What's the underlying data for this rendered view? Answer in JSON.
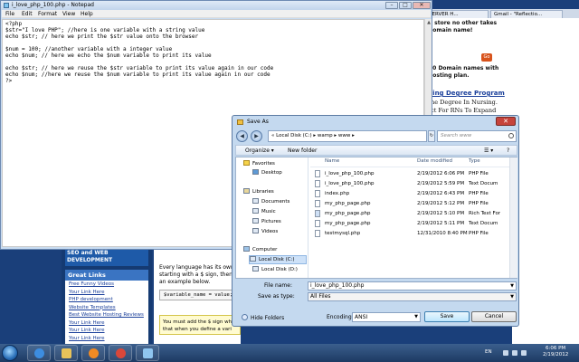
{
  "browser": {
    "tabs": [
      "SERVER H...",
      "Gmail - \"Reflectio..."
    ],
    "domain_lines": [
      "e store no other takes",
      "domain name!",
      "00 Domain names with",
      "hosting plan."
    ],
    "go_label": "Go",
    "promo_heading": "sing Degree Program",
    "promo_lines": [
      "ine Degree In Nursing.",
      "ict For RNs To Expand"
    ]
  },
  "site": {
    "sidebar_heading": "SEO and WEB DEVELOPMENT",
    "great_links_title": "Great Links",
    "great_links": [
      "Free Funny Videos",
      "Your Link Here",
      "PHP development",
      "Website Templates",
      "Best Website Hosting Reviews",
      "Your Link Here",
      "Your Link Here",
      "Your Link Here"
    ],
    "article_lines": [
      "Every language has its own",
      "starting with a $ sign, then",
      "an example below."
    ],
    "code_sample": "$variable_name = value;",
    "note_lines": [
      "You must add the $ sign when",
      "that when you define a vari"
    ]
  },
  "notepad": {
    "title": "i_love_php_100.php - Notepad",
    "menu": [
      "File",
      "Edit",
      "Format",
      "View",
      "Help"
    ],
    "code_lines": [
      "<?php",
      "$str=\"I love PHP\"; //here is one variable with a string value",
      "echo $str; // here we print the $str value onto the browser",
      "",
      "$num = 100; //another variable with a integer value",
      "echo $num; // here we echo the $num variable to print its value",
      "",
      "echo $str; // here we reuse the $str variable to print its value again in our code",
      "echo $num; //here we reuse the $num variable to print its value again in our code",
      "?>"
    ]
  },
  "save_dialog": {
    "title": "Save As",
    "address": "« Local Disk (C:) ▸ wamp ▸ www ▸",
    "search_placeholder": "Search www",
    "toolbar": {
      "organize": "Organize ▾",
      "new_folder": "New folder"
    },
    "nav": {
      "favorites": "Favorites",
      "desktop": "Desktop",
      "libraries": "Libraries",
      "documents": "Documents",
      "music": "Music",
      "pictures": "Pictures",
      "videos": "Videos",
      "computer": "Computer",
      "local_c": "Local Disk (C:)",
      "local_d": "Local Disk (D:)"
    },
    "columns": {
      "name": "Name",
      "date": "Date modified",
      "type": "Type"
    },
    "files": [
      {
        "name": "i_love_php_100.php",
        "date": "2/19/2012 6:06 PM",
        "type": "PHP File"
      },
      {
        "name": "i_love_php_100.php",
        "date": "2/19/2012 5:59 PM",
        "type": "Text Docum"
      },
      {
        "name": "index.php",
        "date": "2/19/2012 6:43 PM",
        "type": "PHP File"
      },
      {
        "name": "my_php_page.php",
        "date": "2/19/2012 5:12 PM",
        "type": "PHP File"
      },
      {
        "name": "my_php_page.php",
        "date": "2/19/2012 5:10 PM",
        "type": "Rich Text For"
      },
      {
        "name": "my_php_page.php",
        "date": "2/19/2012 5:11 PM",
        "type": "Text Docum"
      },
      {
        "name": "testmysql.php",
        "date": "12/31/2010 8:40 PM",
        "type": "PHP File"
      }
    ],
    "file_name_label": "File name:",
    "file_name_value": "i_love_php_100.php",
    "save_as_type_label": "Save as type:",
    "save_as_type_value": "All Files",
    "hide_folders": "Hide Folders",
    "encoding_label": "Encoding:",
    "encoding_value": "ANSI",
    "save_button": "Save",
    "cancel_button": "Cancel"
  },
  "taskbar": {
    "language": "EN",
    "time": "6:06 PM",
    "date": "2/19/2012"
  },
  "colors": {
    "notepad_bg": "#c9dcf1",
    "site_blue": "#1a3f7a",
    "start_orb": "#2a6fb8"
  }
}
